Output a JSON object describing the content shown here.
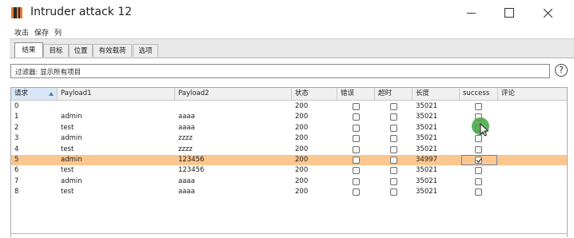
{
  "window": {
    "title": "Intruder attack 12"
  },
  "menu": [
    "攻击",
    "保存",
    "列"
  ],
  "tabs": [
    {
      "label": "结果",
      "active": true
    },
    {
      "label": "目标",
      "active": false
    },
    {
      "label": "位置",
      "active": false
    },
    {
      "label": "有效载荷",
      "active": false
    },
    {
      "label": "选项",
      "active": false
    }
  ],
  "filter": {
    "text": "过滤器: 显示所有项目"
  },
  "help": {
    "glyph": "?"
  },
  "table": {
    "headers": [
      "请求",
      "Payload1",
      "Payload2",
      "状态",
      "错误",
      "超时",
      "长度",
      "success",
      "评论"
    ],
    "sorted_column": "请求",
    "rows": [
      {
        "request": "0",
        "payload1": "",
        "payload2": "",
        "status": "200",
        "error": false,
        "timeout": false,
        "length": "35021",
        "success": false,
        "comment": ""
      },
      {
        "request": "1",
        "payload1": "admin",
        "payload2": "aaaa",
        "status": "200",
        "error": false,
        "timeout": false,
        "length": "35021",
        "success": false,
        "comment": ""
      },
      {
        "request": "2",
        "payload1": "test",
        "payload2": "aaaa",
        "status": "200",
        "error": false,
        "timeout": false,
        "length": "35021",
        "success": false,
        "comment": ""
      },
      {
        "request": "3",
        "payload1": "admin",
        "payload2": "zzzz",
        "status": "200",
        "error": false,
        "timeout": false,
        "length": "35021",
        "success": false,
        "comment": ""
      },
      {
        "request": "4",
        "payload1": "test",
        "payload2": "zzzz",
        "status": "200",
        "error": false,
        "timeout": false,
        "length": "35021",
        "success": false,
        "comment": ""
      },
      {
        "request": "5",
        "payload1": "admin",
        "payload2": "123456",
        "status": "200",
        "error": false,
        "timeout": false,
        "length": "34997",
        "success": true,
        "comment": "",
        "selected": true
      },
      {
        "request": "6",
        "payload1": "test",
        "payload2": "123456",
        "status": "200",
        "error": false,
        "timeout": false,
        "length": "35021",
        "success": false,
        "comment": ""
      },
      {
        "request": "7",
        "payload1": "admin",
        "payload2": "aaaa",
        "status": "200",
        "error": false,
        "timeout": false,
        "length": "35021",
        "success": false,
        "comment": ""
      },
      {
        "request": "8",
        "payload1": "test",
        "payload2": "aaaa",
        "status": "200",
        "error": false,
        "timeout": false,
        "length": "35021",
        "success": false,
        "comment": ""
      }
    ]
  },
  "colors": {
    "selected_row": "#fbc78f",
    "cursor_highlight": "#46a546",
    "app_icon": "#e9762c"
  }
}
